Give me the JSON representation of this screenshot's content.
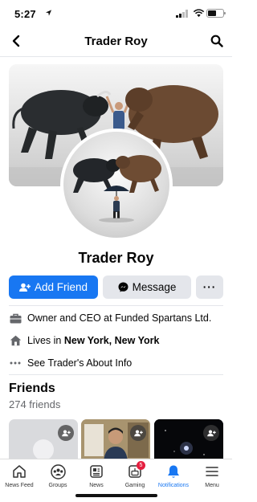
{
  "status_bar": {
    "time": "5:27"
  },
  "header": {
    "title": "Trader Roy"
  },
  "profile": {
    "name": "Trader Roy",
    "actions": {
      "add_friend": "Add Friend",
      "message": "Message",
      "more": "···"
    }
  },
  "intro": {
    "work": "Owner and CEO at Funded Spartans Ltd.",
    "lives_prefix": "Lives in ",
    "lives_city": "New York, New York",
    "about": "See Trader's About Info"
  },
  "friends": {
    "title": "Friends",
    "count": "274 friends"
  },
  "tabbar": {
    "items": [
      {
        "label": "News Feed",
        "icon": "home-icon"
      },
      {
        "label": "Groups",
        "icon": "groups-icon"
      },
      {
        "label": "News",
        "icon": "news-icon"
      },
      {
        "label": "Gaming",
        "icon": "gaming-icon",
        "badge": "5"
      },
      {
        "label": "Notifications",
        "icon": "bell-icon",
        "active": true
      },
      {
        "label": "Menu",
        "icon": "menu-icon"
      }
    ]
  },
  "colors": {
    "accent": "#1877f2",
    "badge": "#e41e3f",
    "secondary_button": "#e4e6eb",
    "muted_text": "#65676b"
  }
}
